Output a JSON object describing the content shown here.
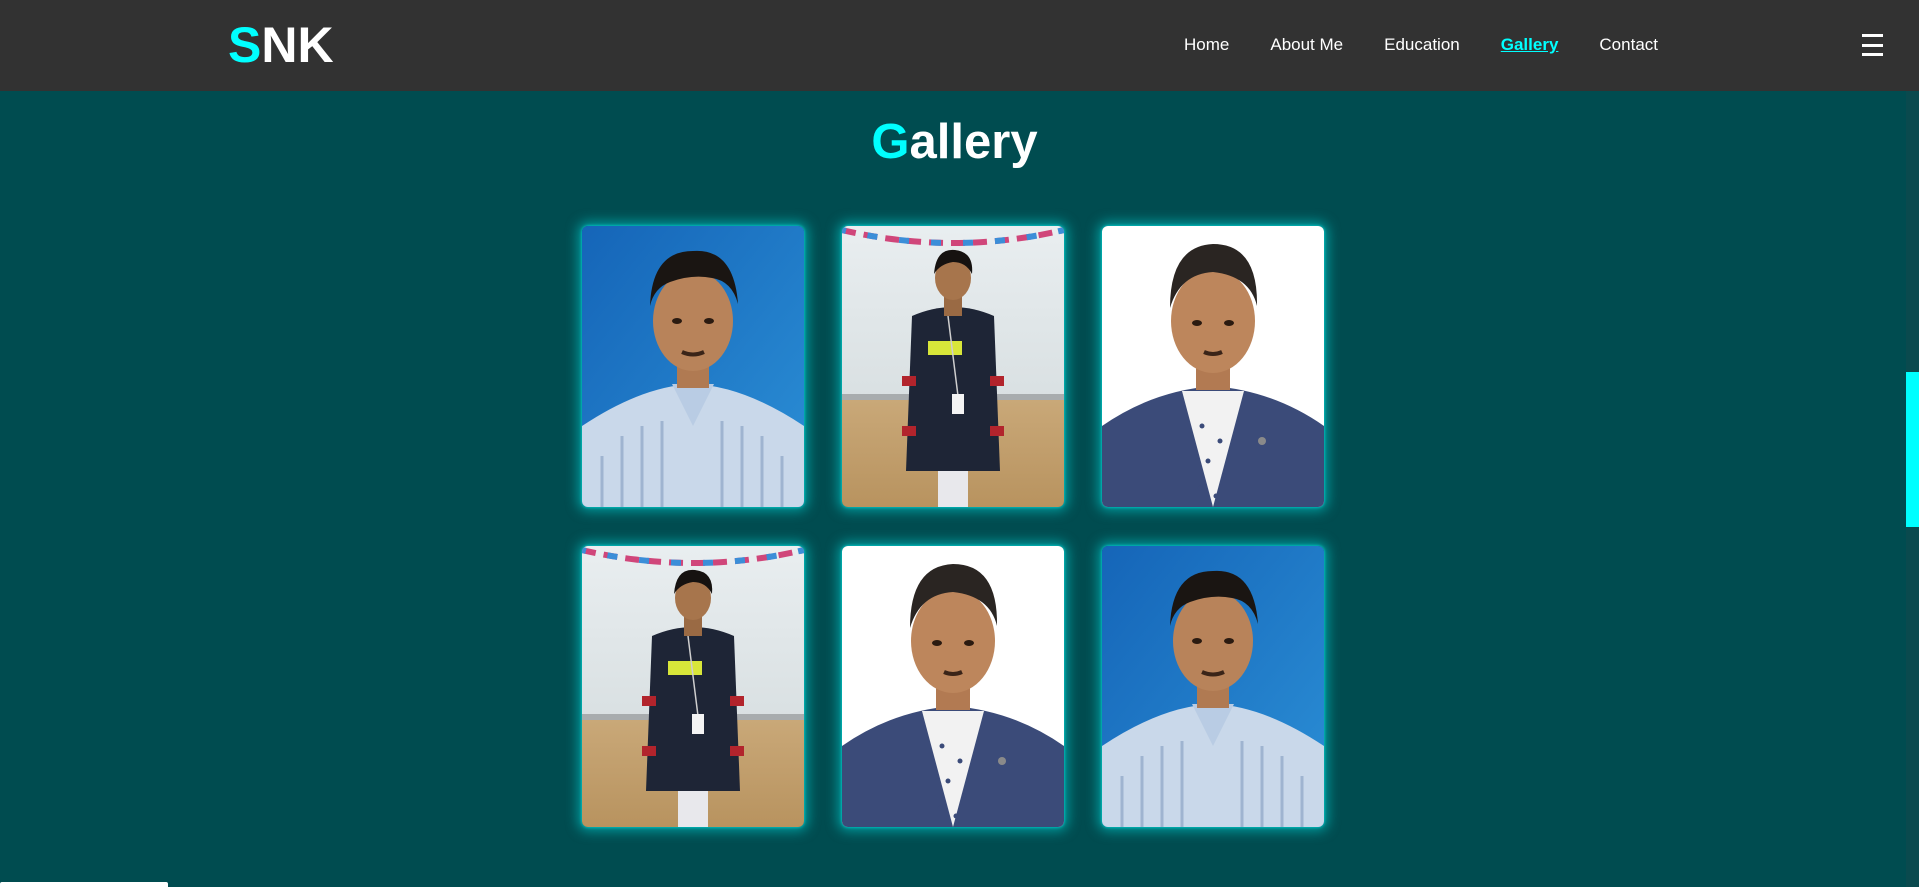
{
  "logo": {
    "accent_letter": "S",
    "rest": "NK"
  },
  "nav": {
    "items": [
      {
        "label": "Home",
        "active": false
      },
      {
        "label": "About Me",
        "active": false
      },
      {
        "label": "Education",
        "active": false
      },
      {
        "label": "Gallery",
        "active": true
      },
      {
        "label": "Contact",
        "active": false
      }
    ],
    "menu_icon": "hamburger-icon"
  },
  "gallery": {
    "title_accent": "G",
    "title_rest": "allery",
    "photos": [
      {
        "kind": "portrait-blue-bg-striped-shirt"
      },
      {
        "kind": "full-body-whiteboard-sweater"
      },
      {
        "kind": "portrait-white-bg-blazer"
      },
      {
        "kind": "full-body-whiteboard-sweater"
      },
      {
        "kind": "portrait-white-bg-blazer"
      },
      {
        "kind": "portrait-blue-bg-striped-shirt"
      }
    ]
  },
  "colors": {
    "accent": "#00ffff",
    "navbar_bg": "#323232",
    "page_bg": "#004c50"
  }
}
